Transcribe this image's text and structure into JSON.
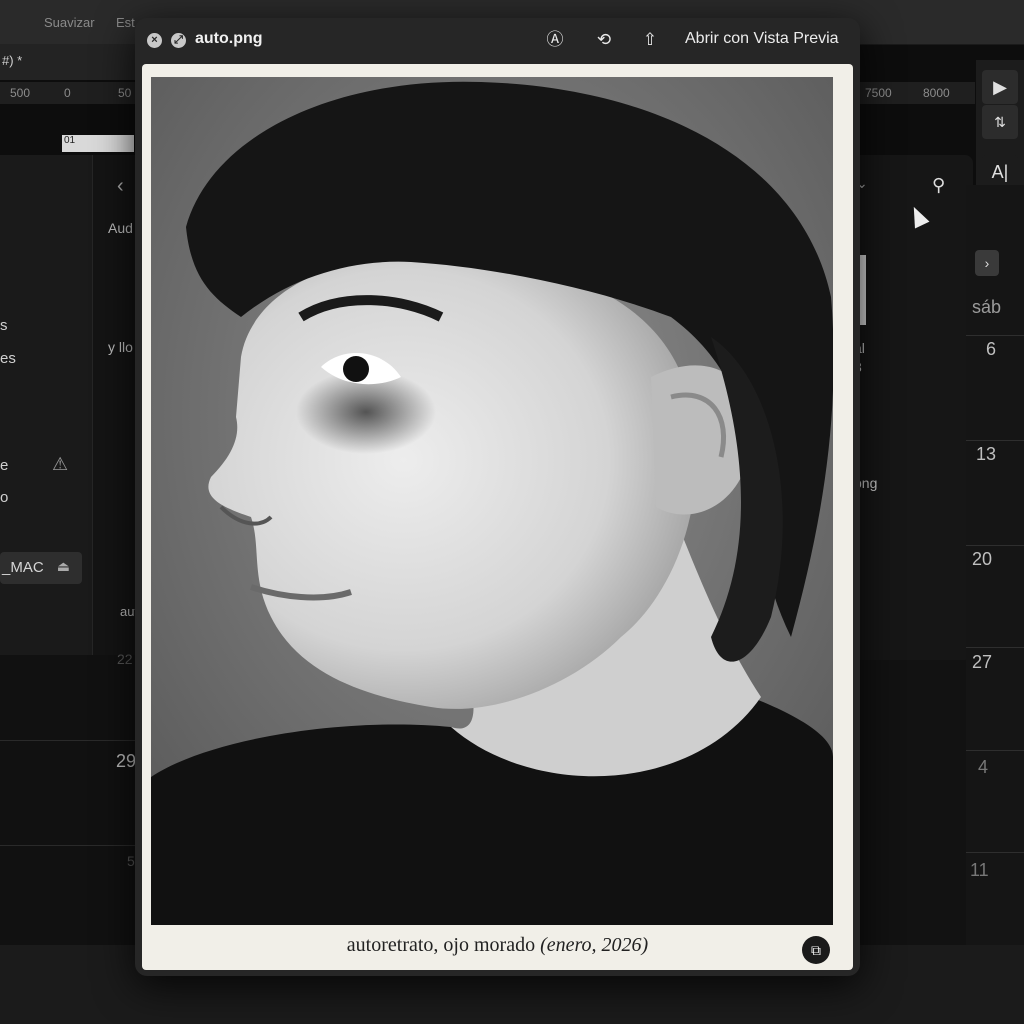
{
  "background_app": {
    "toolbar": {
      "item_1": "Suavizar",
      "item_2": "Est"
    },
    "tab_label": "#) *",
    "ruler_labels": [
      "500",
      "0",
      "50",
      "7500",
      "8000"
    ],
    "timecode": "01",
    "sidebar_items": [
      "s",
      "es",
      "e",
      "o"
    ],
    "drive_label": "_MAC",
    "panel_texts": [
      "Aud",
      "y llo",
      "aut"
    ],
    "right_panel_texts": [
      "al",
      "3",
      "png"
    ]
  },
  "calendar": {
    "weekday_label": "sáb",
    "right_days": [
      "6",
      "13",
      "20",
      "27",
      "4",
      "11"
    ],
    "left_days": [
      "22",
      "29",
      "5"
    ]
  },
  "quicklook": {
    "filename": "auto.png",
    "open_with_label": "Abrir con Vista Previa",
    "caption_main": "autoretrato, ojo morado",
    "caption_date": "(enero, 2026)",
    "icons": [
      "close-icon",
      "fullscreen-icon",
      "markup-icon",
      "rotate-icon",
      "share-icon",
      "live-text-icon"
    ]
  },
  "colors": {
    "window_bg": "#262626",
    "paper": "#f1efe8",
    "desktop": "#0d0d0d"
  }
}
